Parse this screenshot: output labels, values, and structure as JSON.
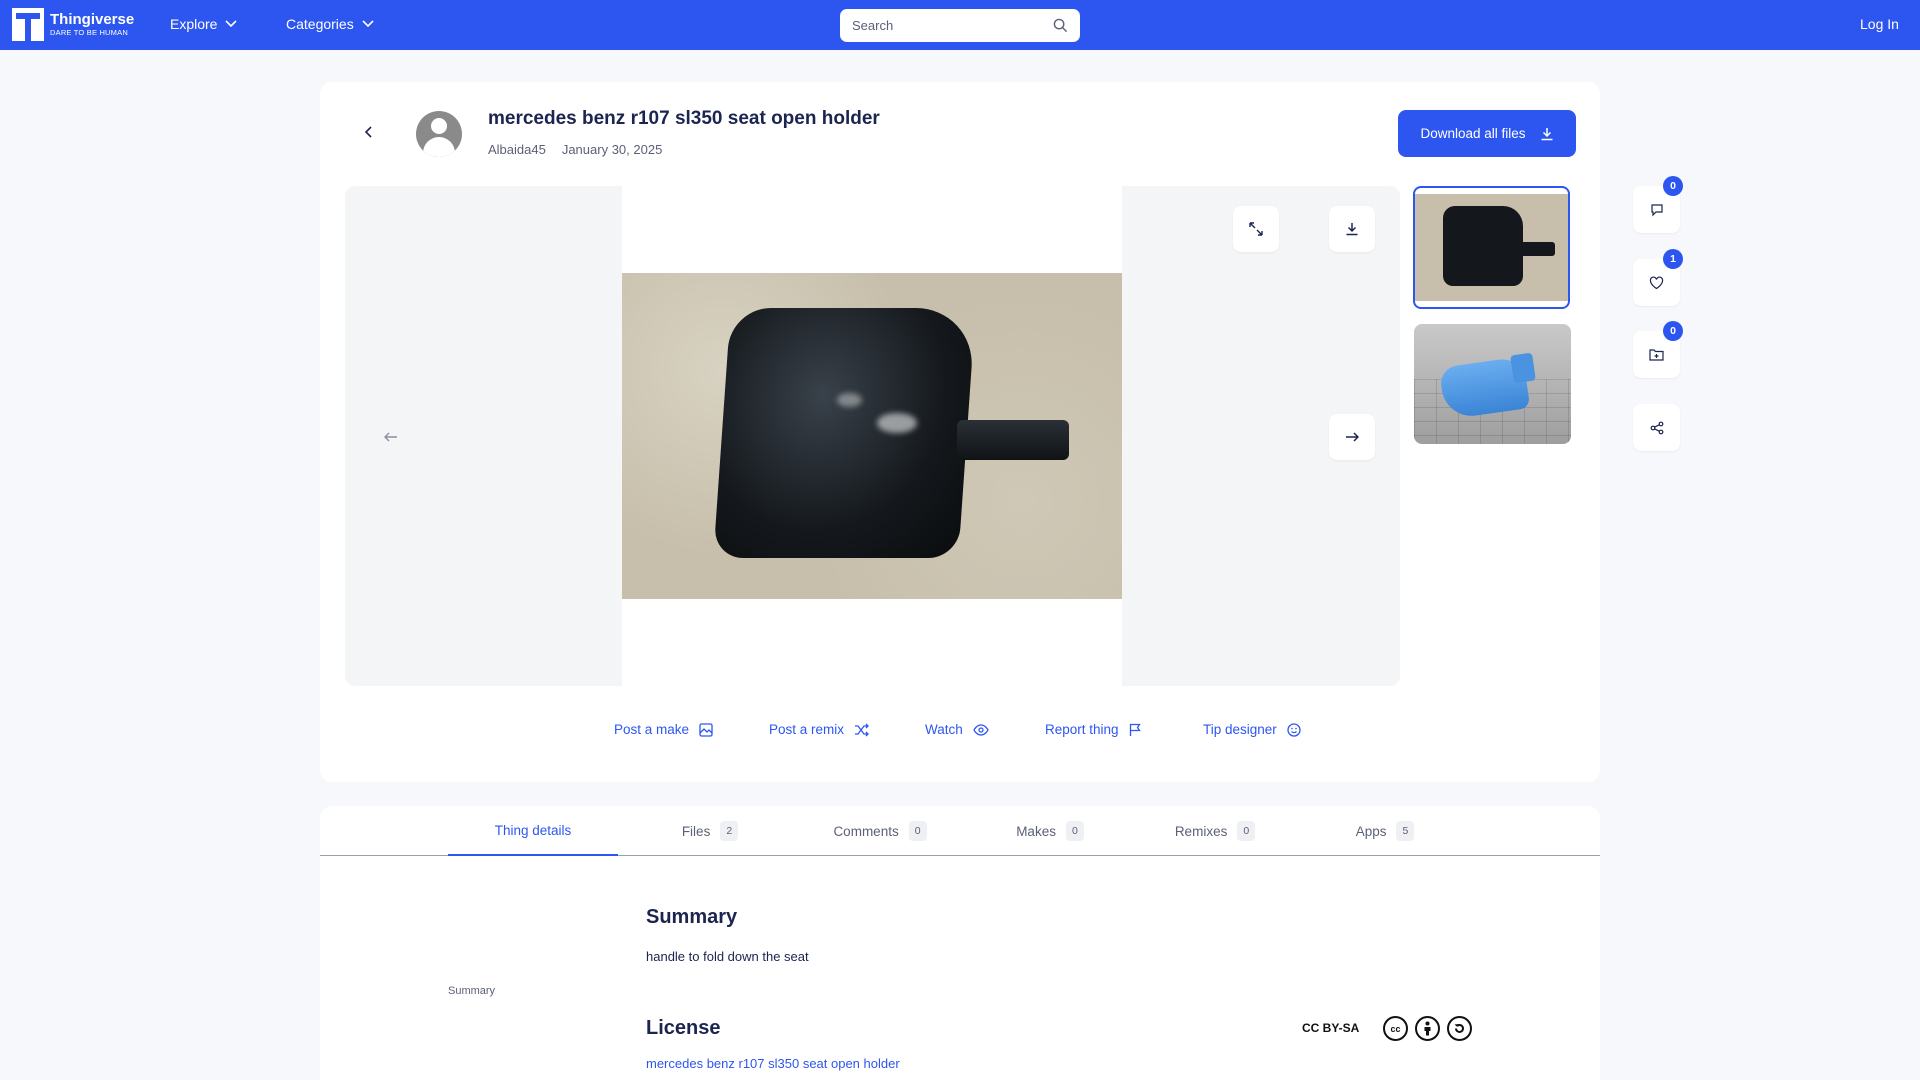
{
  "nav": {
    "brand": "Thingiverse",
    "tagline": "DARE TO BE HUMAN",
    "explore_label": "Explore",
    "categories_label": "Categories",
    "search_placeholder": "Search",
    "search_value": "",
    "login_label": "Log In",
    "colors": {
      "primary": "#2d56f0"
    }
  },
  "thing": {
    "title": "mercedes benz r107 sl350 seat open holder",
    "author": "Albaida45",
    "date": "January 30, 2025",
    "download_all_label": "Download all files"
  },
  "actions": [
    {
      "label": "Post a make",
      "icon": "image-icon"
    },
    {
      "label": "Post a remix",
      "icon": "shuffle-icon"
    },
    {
      "label": "Watch",
      "icon": "eye-icon"
    },
    {
      "label": "Report thing",
      "icon": "flag-icon"
    },
    {
      "label": "Tip designer",
      "icon": "smile-icon"
    }
  ],
  "rail": {
    "comments_count": "0",
    "likes_count": "1",
    "collections_count": "0"
  },
  "tabs": [
    {
      "label": "Thing details",
      "count": ""
    },
    {
      "label": "Files",
      "count": "2"
    },
    {
      "label": "Comments",
      "count": "0"
    },
    {
      "label": "Makes",
      "count": "0"
    },
    {
      "label": "Remixes",
      "count": "0"
    },
    {
      "label": "Apps",
      "count": "5"
    }
  ],
  "details": {
    "side_nav_summary": "Summary",
    "summary_title": "Summary",
    "summary_text": "handle to fold down the seat",
    "license_title": "License",
    "license_link": "mercedes benz r107 sl350 seat open holder",
    "license_type": "CC BY-SA"
  }
}
